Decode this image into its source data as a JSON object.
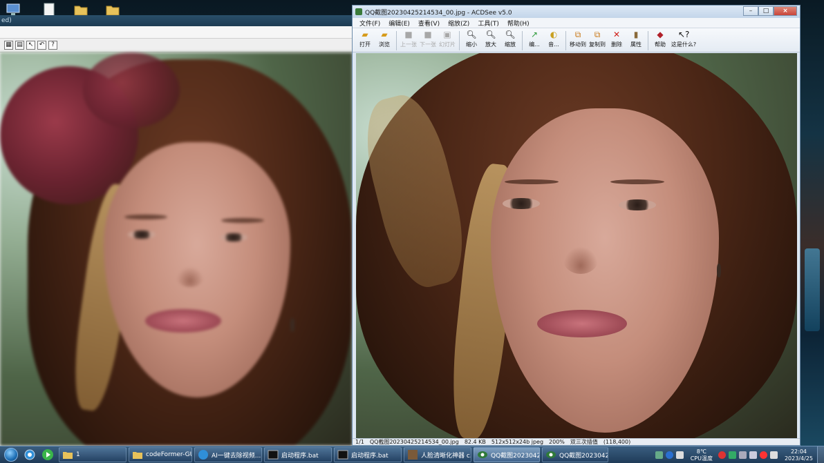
{
  "desktop": {
    "left_window": {
      "title_fragment": "ed)"
    },
    "icons": [
      "computer-icon",
      "document-icon",
      "folder-icon",
      "folder-icon"
    ]
  },
  "acdsee": {
    "title": "QQ截图20230425214534_00.jpg - ACDSee v5.0",
    "window_buttons": {
      "minimize": "–",
      "maximize": "□",
      "close": "×"
    },
    "menu": [
      "文件(F)",
      "编辑(E)",
      "查看(V)",
      "缩放(Z)",
      "工具(T)",
      "帮助(H)"
    ],
    "toolbar": [
      {
        "label": "打开",
        "icon": "open-folder-icon",
        "enabled": true
      },
      {
        "label": "浏览",
        "icon": "browse-folder-icon",
        "enabled": true
      },
      {
        "label": "上一张",
        "icon": "prev-image-icon",
        "enabled": false
      },
      {
        "label": "下一张",
        "icon": "next-image-icon",
        "enabled": false
      },
      {
        "label": "幻灯片",
        "icon": "slideshow-icon",
        "enabled": false
      },
      {
        "label": "缩小",
        "icon": "zoom-out-icon",
        "enabled": true
      },
      {
        "label": "放大",
        "icon": "zoom-in-icon",
        "enabled": true
      },
      {
        "label": "缩放",
        "icon": "zoom-icon",
        "enabled": true
      },
      {
        "label": "编...",
        "icon": "edit-icon",
        "enabled": true
      },
      {
        "label": "音...",
        "icon": "audio-icon",
        "enabled": true
      },
      {
        "label": "移动到",
        "icon": "move-to-icon",
        "enabled": true
      },
      {
        "label": "复制到",
        "icon": "copy-to-icon",
        "enabled": true
      },
      {
        "label": "删除",
        "icon": "delete-icon",
        "enabled": true
      },
      {
        "label": "属性",
        "icon": "properties-icon",
        "enabled": true
      },
      {
        "label": "帮助",
        "icon": "help-book-icon",
        "enabled": true
      },
      {
        "label": "这是什么?",
        "icon": "whats-this-icon",
        "enabled": true
      }
    ],
    "status": {
      "index": "1/1",
      "filename": "QQ截图20230425214534_00.jpg",
      "size": "82.4 KB",
      "dimensions": "512x512x24b jpeg",
      "zoom": "200%",
      "mode": "双三次插值",
      "coords": "(118,400)"
    }
  },
  "taskbar": {
    "tasks": [
      {
        "label": "1",
        "icon": "folder-icon",
        "active": false
      },
      {
        "label": "codeFormer-GU...",
        "icon": "folder-icon",
        "active": false
      },
      {
        "label": "AI一键去除视频...",
        "icon": "browser-icon",
        "active": false
      },
      {
        "label": "启动程序.bat",
        "icon": "console-icon",
        "active": false
      },
      {
        "label": "启动程序.bat",
        "icon": "console-icon",
        "active": false
      },
      {
        "label": "人脸清晰化神器 c...",
        "icon": "app-icon",
        "active": false
      },
      {
        "label": "QQ截图2023042...",
        "icon": "acdsee-icon",
        "active": true
      },
      {
        "label": "QQ截图2023042...",
        "icon": "acdsee-icon",
        "active": false
      }
    ],
    "tray": {
      "temperature": "8℃",
      "temp_label": "CPU温度",
      "time": "22:04",
      "date": "2023/4/25"
    }
  }
}
